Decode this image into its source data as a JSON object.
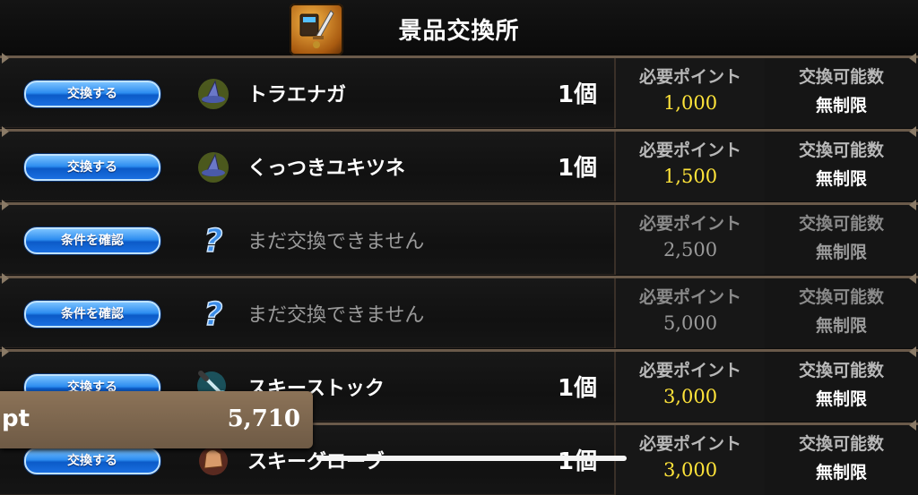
{
  "header": {
    "title": "景品交換所",
    "icon": "shop-sword-icon"
  },
  "columns": {
    "points_label": "必要ポイント",
    "limit_label": "交換可能数"
  },
  "rows": [
    {
      "button": "交換する",
      "icon": "wizard-hat-icon",
      "name": "トラエナガ",
      "qty": "1個",
      "points": "1,000",
      "limit": "無制限",
      "locked": false
    },
    {
      "button": "交換する",
      "icon": "wizard-hat-icon",
      "name": "くっつきユキツネ",
      "qty": "1個",
      "points": "1,500",
      "limit": "無制限",
      "locked": false
    },
    {
      "button": "条件を確認",
      "icon": "question-icon",
      "name": "まだ交換できません",
      "qty": "",
      "points": "2,500",
      "limit": "無制限",
      "locked": true
    },
    {
      "button": "条件を確認",
      "icon": "question-icon",
      "name": "まだ交換できません",
      "qty": "",
      "points": "5,000",
      "limit": "無制限",
      "locked": true
    },
    {
      "button": "交換する",
      "icon": "ski-stock-icon",
      "name": "スキーストック",
      "qty": "1個",
      "points": "3,000",
      "limit": "無制限",
      "locked": false
    },
    {
      "button": "交換する",
      "icon": "ski-glove-icon",
      "name": "スキーグローブ",
      "qty": "1個",
      "points": "3,000",
      "limit": "無制限",
      "locked": false
    }
  ],
  "points_popup": {
    "unit": "pt",
    "value": "5,710"
  },
  "colors": {
    "button_blue": "#2d8df0",
    "points_yellow": "#ffe43a",
    "locked_gray": "#9a9a9a"
  }
}
